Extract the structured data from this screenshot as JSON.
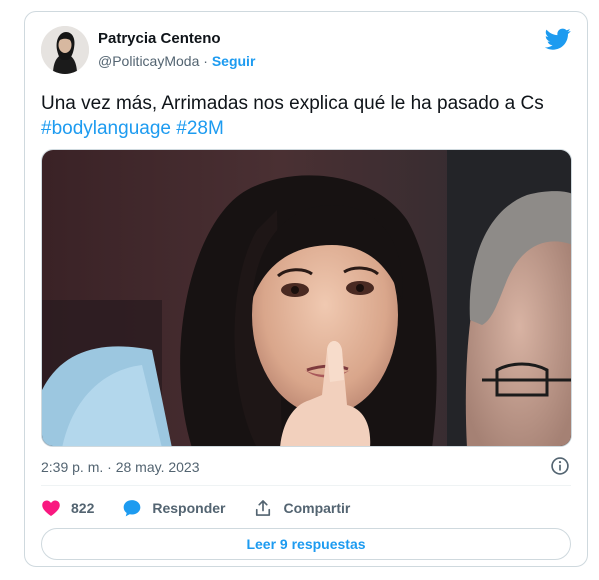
{
  "author": {
    "name": "Patrycia Centeno",
    "handle": "@PoliticayModa",
    "separator": " · ",
    "follow_label": "Seguir"
  },
  "tweet": {
    "text": "Una vez más, Arrimadas nos explica qué le ha pasado a Cs",
    "hashtags": [
      "#bodylanguage",
      "#28M"
    ],
    "timestamp": "2:39 p. m. · 28 may. 2023"
  },
  "actions": {
    "likes": "822",
    "reply_label": "Responder",
    "share_label": "Compartir"
  },
  "read_replies_label": "Leer 9 respuestas",
  "colors": {
    "accent": "#1d9bf0",
    "like": "#f91880",
    "text": "#0f1419",
    "secondary": "#536471",
    "border": "#cfd9de"
  },
  "icons": {
    "brand": "twitter-bird-icon",
    "like": "heart-icon",
    "reply": "speech-bubble-icon",
    "share": "share-icon",
    "info": "info-icon"
  }
}
